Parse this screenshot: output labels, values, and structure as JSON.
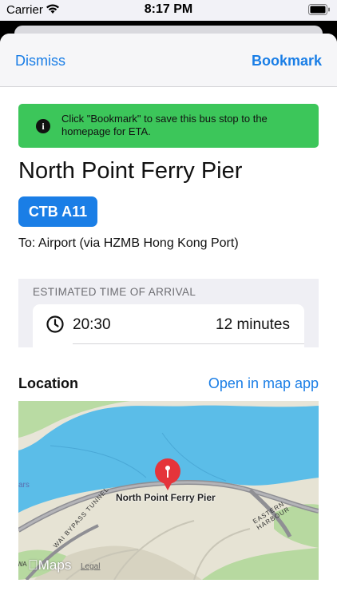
{
  "status_bar": {
    "carrier": "Carrier",
    "time": "8:17 PM"
  },
  "nav": {
    "dismiss": "Dismiss",
    "bookmark": "Bookmark"
  },
  "banner": {
    "icon": "info-icon",
    "glyph": "i",
    "text": "Click \"Bookmark\" to save this bus stop to the homepage for ETA."
  },
  "stop": {
    "name": "North Point Ferry Pier",
    "route": "CTB A11",
    "destination": "To: Airport (via HZMB Hong Kong Port)"
  },
  "eta": {
    "header": "ESTIMATED TIME OF ARRIVAL",
    "rows": [
      {
        "time": "20:30",
        "minutes": "12 minutes"
      }
    ]
  },
  "location": {
    "label": "Location",
    "open_map": "Open in map app",
    "map": {
      "pin_label": "North Point Ferry Pier",
      "labels": {
        "tunnel": "WAI BYPASS TUNNEL",
        "harbour": "EASTERN HARBOUR",
        "ars": "ars",
        "waiwai": "WA"
      },
      "logo": "Maps",
      "legal": "Legal"
    }
  },
  "colors": {
    "accent": "#1a7ee6",
    "banner": "#3cc65a",
    "water": "#5bbde8",
    "land": "#e6e3d4",
    "park": "#b7d9a0",
    "pin": "#e5343a"
  }
}
